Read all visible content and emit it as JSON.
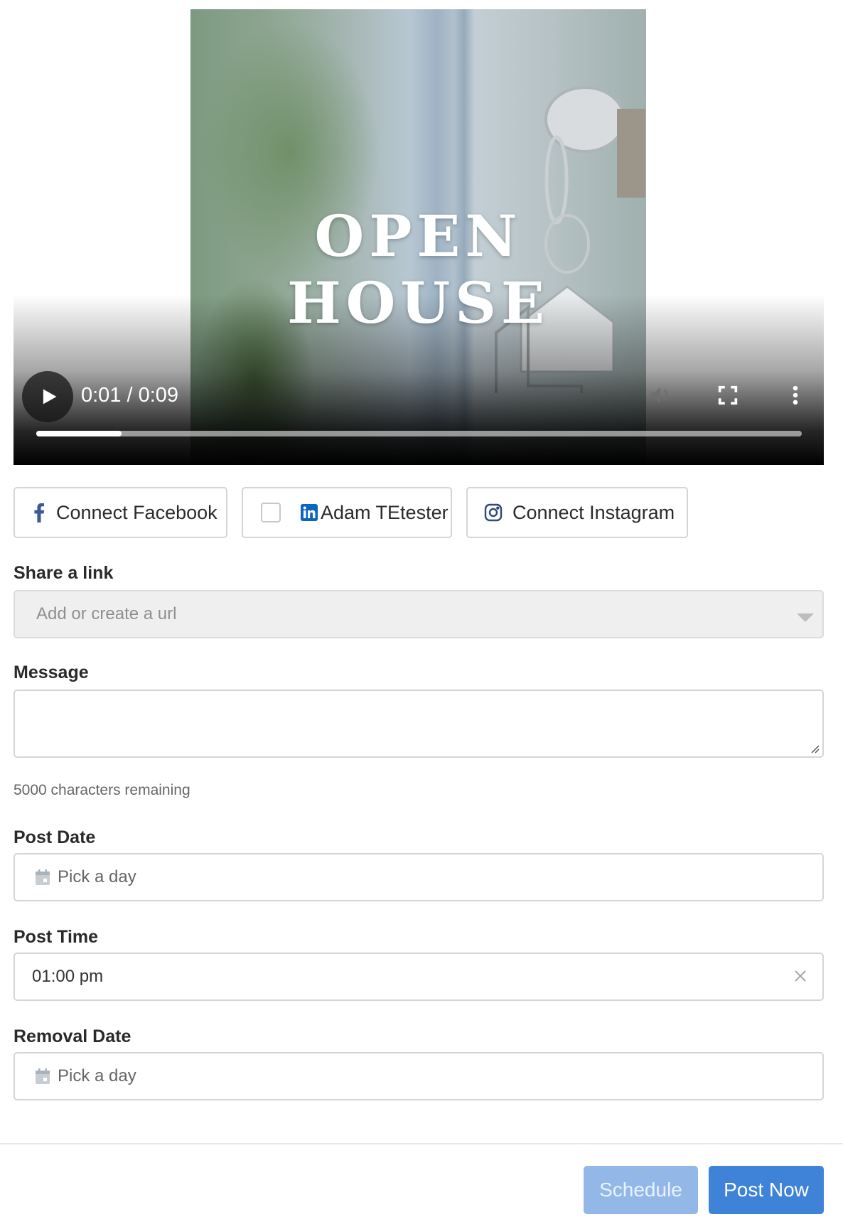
{
  "video": {
    "overlay_title": "OPEN HOUSE",
    "time_display": "0:01 / 0:09",
    "progress_fraction": 0.111,
    "controls": {
      "play": "play-icon",
      "volume": "volume-icon",
      "fullscreen": "fullscreen-icon",
      "more": "more-vert-icon"
    }
  },
  "social": {
    "facebook": {
      "label": "Connect Facebook",
      "icon": "facebook-icon"
    },
    "linkedin": {
      "label": "Adam TEtester",
      "icon": "linkedin-icon",
      "checked": false
    },
    "instagram": {
      "label": "Connect Instagram",
      "icon": "instagram-icon"
    }
  },
  "form": {
    "link": {
      "label": "Share a link",
      "placeholder": "Add or create a url"
    },
    "message": {
      "label": "Message",
      "value": "",
      "helper": "5000 characters remaining"
    },
    "post_date": {
      "label": "Post Date",
      "placeholder": "Pick a day"
    },
    "post_time": {
      "label": "Post Time",
      "value": "01:00 pm"
    },
    "removal_date": {
      "label": "Removal Date",
      "placeholder": "Pick a day"
    }
  },
  "actions": {
    "schedule": "Schedule",
    "post_now": "Post Now"
  },
  "colors": {
    "primary": "#3f83d8",
    "primary_disabled": "#93b8e8",
    "facebook": "#3b5998",
    "linkedin": "#0a66c2",
    "instagram": "#2d4a7a"
  }
}
